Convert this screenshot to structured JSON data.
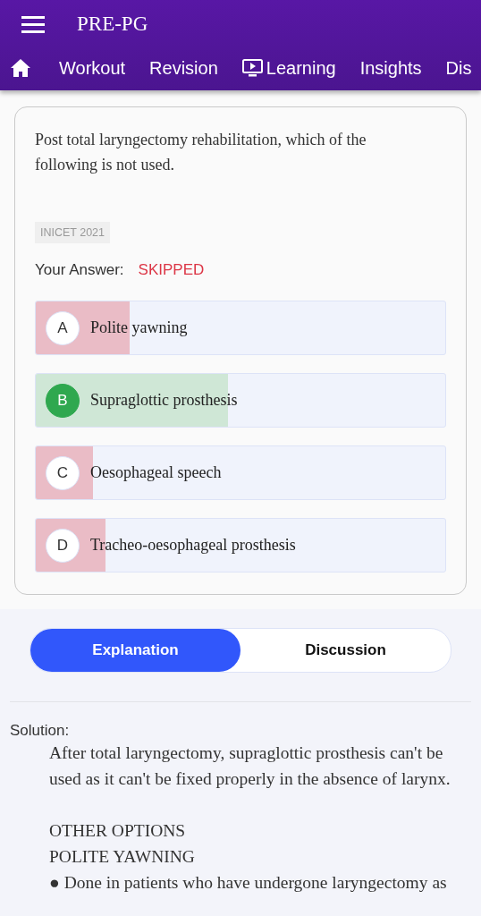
{
  "app_bar": {
    "title": "PRE-PG"
  },
  "nav": [
    {
      "label": "Workout",
      "kind": "plain"
    },
    {
      "label": "Revision",
      "kind": "plain"
    },
    {
      "label": "Learning",
      "kind": "with_icon"
    },
    {
      "label": "Insights",
      "kind": "plain"
    },
    {
      "label": "Dis",
      "kind": "plain"
    }
  ],
  "question": {
    "text": "Post total laryngectomy rehabilitation, which of the following is not used.",
    "tag": "INICET 2021",
    "answer_label": "Your Answer:",
    "answer_value": "SKIPPED",
    "options": [
      {
        "letter": "A",
        "text": "Polite yawning",
        "correct": false,
        "level": 0.23
      },
      {
        "letter": "B",
        "text": "Supraglottic prosthesis",
        "correct": true,
        "level": 0.47
      },
      {
        "letter": "C",
        "text": "Oesophageal speech",
        "correct": false,
        "level": 0.14
      },
      {
        "letter": "D",
        "text": "Tracheo-oesophageal prosthesis",
        "correct": false,
        "level": 0.17
      }
    ]
  },
  "tabs": [
    {
      "label": "Explanation",
      "selected": true
    },
    {
      "label": "Discussion",
      "selected": false
    }
  ],
  "solution": {
    "label": "Solution:",
    "blocks": [
      [
        "After total laryngectomy, supraglottic prosthesis can't be used as it can't be fixed properly in the absence of larynx."
      ],
      [
        "OTHER OPTIONS",
        "POLITE YAWNING",
        "● Done in patients who have undergone laryngectomy as"
      ]
    ]
  }
}
